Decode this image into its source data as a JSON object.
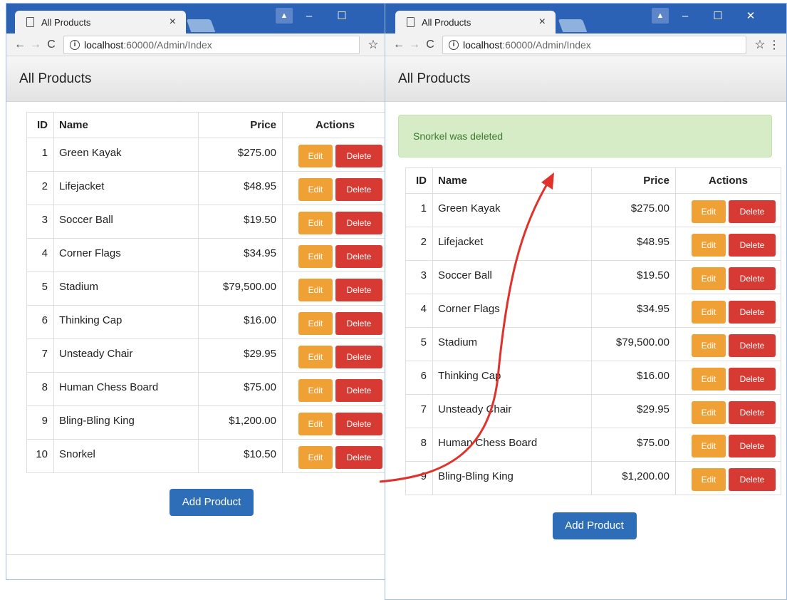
{
  "window_left": {
    "tab_title": "All Products",
    "tab_close": "×",
    "url_host": "localhost",
    "url_rest": ":60000/Admin/Index",
    "heading": "All Products",
    "table": {
      "headers": [
        "ID",
        "Name",
        "Price",
        "Actions"
      ],
      "rows": [
        {
          "id": "1",
          "name": "Green Kayak",
          "price": "$275.00"
        },
        {
          "id": "2",
          "name": "Lifejacket",
          "price": "$48.95"
        },
        {
          "id": "3",
          "name": "Soccer Ball",
          "price": "$19.50"
        },
        {
          "id": "4",
          "name": "Corner Flags",
          "price": "$34.95"
        },
        {
          "id": "5",
          "name": "Stadium",
          "price": "$79,500.00"
        },
        {
          "id": "6",
          "name": "Thinking Cap",
          "price": "$16.00"
        },
        {
          "id": "7",
          "name": "Unsteady Chair",
          "price": "$29.95"
        },
        {
          "id": "8",
          "name": "Human Chess Board",
          "price": "$75.00"
        },
        {
          "id": "9",
          "name": "Bling-Bling King",
          "price": "$1,200.00"
        },
        {
          "id": "10",
          "name": "Snorkel",
          "price": "$10.50"
        }
      ]
    },
    "edit_label": "Edit",
    "delete_label": "Delete",
    "add_label": "Add Product"
  },
  "window_right": {
    "tab_title": "All Products",
    "tab_close": "×",
    "url_host": "localhost",
    "url_rest": ":60000/Admin/Index",
    "heading": "All Products",
    "alert": "Snorkel was deleted",
    "table": {
      "headers": [
        "ID",
        "Name",
        "Price",
        "Actions"
      ],
      "rows": [
        {
          "id": "1",
          "name": "Green Kayak",
          "price": "$275.00"
        },
        {
          "id": "2",
          "name": "Lifejacket",
          "price": "$48.95"
        },
        {
          "id": "3",
          "name": "Soccer Ball",
          "price": "$19.50"
        },
        {
          "id": "4",
          "name": "Corner Flags",
          "price": "$34.95"
        },
        {
          "id": "5",
          "name": "Stadium",
          "price": "$79,500.00"
        },
        {
          "id": "6",
          "name": "Thinking Cap",
          "price": "$16.00"
        },
        {
          "id": "7",
          "name": "Unsteady Chair",
          "price": "$29.95"
        },
        {
          "id": "8",
          "name": "Human Chess Board",
          "price": "$75.00"
        },
        {
          "id": "9",
          "name": "Bling-Bling King",
          "price": "$1,200.00"
        }
      ]
    },
    "edit_label": "Edit",
    "delete_label": "Delete",
    "add_label": "Add Product"
  },
  "colors": {
    "titlebar": "#2c62b5",
    "edit_button": "#efa136",
    "delete_button": "#d63a33",
    "add_button": "#2e6db8",
    "alert_bg": "#d5ecc7",
    "arrow": "#e0312b"
  },
  "icons": {
    "page": "page-icon",
    "back": "back-arrow-icon",
    "forward": "forward-arrow-icon",
    "reload": "reload-icon",
    "info": "info-icon",
    "bookmark": "star-icon",
    "menu": "kebab-menu-icon",
    "account": "account-icon",
    "minimize": "minimize-icon",
    "maximize": "maximize-icon",
    "close": "close-icon"
  }
}
